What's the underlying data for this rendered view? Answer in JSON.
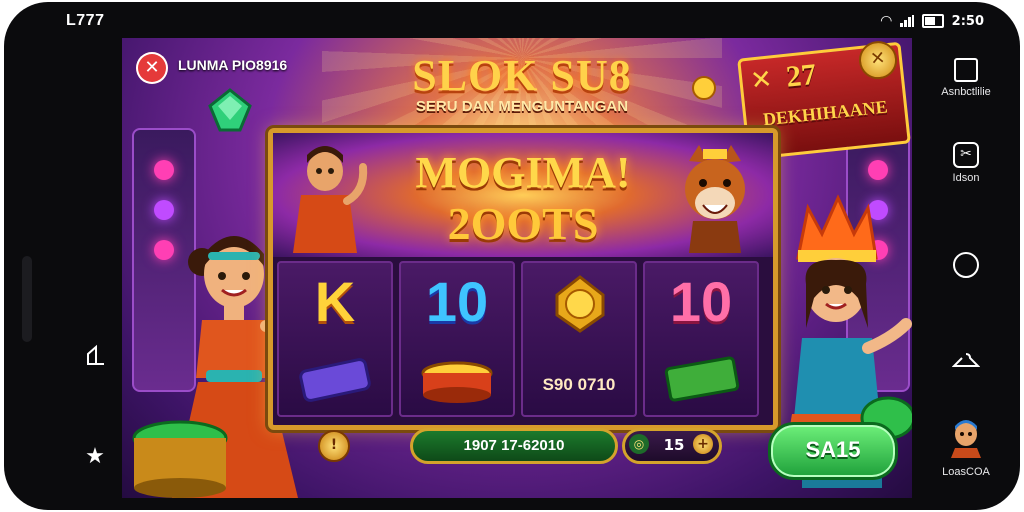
{
  "status_bar": {
    "left_text": "L777",
    "time": "2:50"
  },
  "left_rail": {
    "home_label": "",
    "favorite_label": ""
  },
  "game": {
    "close_glyph": "✕",
    "player_label": "LUNMA PIO8916",
    "title": "SLOK SU8",
    "subtitle": "SERU DAN MENGUNTANGAN",
    "badge": {
      "number": "27",
      "label": "DEKHIHAANE",
      "x_glyph": "✕"
    },
    "banner": {
      "line1": "MOGIMA!",
      "line2": "2OOTS"
    },
    "reels": [
      {
        "top": "K",
        "bottom_amount": ""
      },
      {
        "top": "10",
        "bottom_amount": ""
      },
      {
        "top": "",
        "bottom_amount": "S90 0710"
      },
      {
        "top": "10",
        "bottom_amount": ""
      }
    ],
    "bottom_bar": {
      "coin_glyph": "!",
      "balance": "1907 17-62010",
      "bet_minus_glyph": "◎",
      "bet_value": "15",
      "bet_plus_glyph": "+"
    },
    "spin_label": "SA15",
    "colors": {
      "accent_gold": "#ffd24a",
      "spin_green": "#1ea03a",
      "close_red": "#e53a3a"
    }
  },
  "right_rail": {
    "items": [
      {
        "label": "Asnbctlilie",
        "icon": "square-icon"
      },
      {
        "label": "Idson",
        "icon": "tool-icon"
      },
      {
        "label": "",
        "icon": "circle-icon"
      },
      {
        "label": "",
        "icon": "hanger-icon"
      },
      {
        "label": "LoasCOA",
        "icon": "avatar-icon"
      }
    ]
  }
}
